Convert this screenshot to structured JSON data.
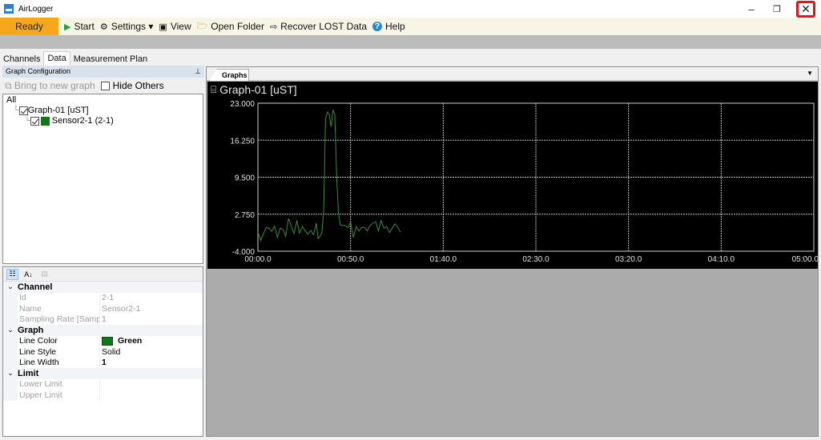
{
  "window": {
    "title": "AirLogger",
    "minimize": "–",
    "maximize": "❐",
    "close": "✕"
  },
  "toolbar": {
    "status": "Ready",
    "items": [
      {
        "icon": "play-icon",
        "glyph": "▶",
        "label": "Start"
      },
      {
        "icon": "gear-icon",
        "glyph": "⚙",
        "label": "Settings ▾"
      },
      {
        "icon": "chart-icon",
        "glyph": "▣",
        "label": "View"
      },
      {
        "icon": "folder-icon",
        "glyph": "🗁",
        "label": "Open Folder"
      },
      {
        "icon": "recover-icon",
        "glyph": "⇨",
        "label": "Recover LOST Data"
      },
      {
        "icon": "help-icon",
        "glyph": "?",
        "label": "Help"
      }
    ]
  },
  "left_tabs": [
    {
      "label": "Channels"
    },
    {
      "label": "Data",
      "active": true
    },
    {
      "label": "Measurement Plan"
    }
  ],
  "graph_config": {
    "header": "Graph Configuration",
    "pin": "⊥",
    "bring_label": "Bring to new graph",
    "hide_others_label": "Hide Others",
    "tree": {
      "root": "All",
      "graph": "Graph-01 [uST]",
      "sensor": "Sensor2-1 (2-1)",
      "sensor_color": "#0b7a16"
    }
  },
  "properties": {
    "categories": [
      {
        "name": "Channel",
        "rows": [
          {
            "key": "Id",
            "value": "2-1",
            "disabled": true
          },
          {
            "key": "Name",
            "value": "Sensor2-1",
            "disabled": true
          },
          {
            "key": "Sampling Rate [Samp",
            "value": "1",
            "disabled": true
          }
        ]
      },
      {
        "name": "Graph",
        "rows": [
          {
            "key": "Line Color",
            "value": "Green",
            "swatch": "#0b7a16"
          },
          {
            "key": "Line Style",
            "value": "Solid"
          },
          {
            "key": "Line Width",
            "value": "1"
          }
        ]
      },
      {
        "name": "Limit",
        "rows": [
          {
            "key": "Lower Limit",
            "value": "",
            "disabled": true
          },
          {
            "key": "Upper Limit",
            "value": "",
            "disabled": true
          }
        ]
      }
    ]
  },
  "graphs_tab": {
    "label": "Graphs",
    "dropdown": "▼"
  },
  "graph": {
    "title": "Graph-01 [uST]"
  },
  "chart_data": {
    "type": "line",
    "title": "Graph-01 [uST]",
    "xlabel": "",
    "ylabel": "",
    "xlim": [
      0,
      300
    ],
    "ylim": [
      -4.0,
      23.0
    ],
    "yticks": [
      "23.000",
      "16.250",
      "9.500",
      "2.750",
      "-4.000"
    ],
    "ytick_values": [
      23.0,
      16.25,
      9.5,
      2.75,
      -4.0
    ],
    "xticks": [
      "00:00.0",
      "00:50.0",
      "01:40.0",
      "02:30.0",
      "03:20.0",
      "04:10.0",
      "05:00.0"
    ],
    "xtick_values": [
      0,
      50,
      100,
      150,
      200,
      250,
      300
    ],
    "grid": true,
    "series": [
      {
        "name": "Sensor2-1 (2-1)",
        "color": "#3d8a3d",
        "x": [
          0,
          1.5,
          3,
          4.5,
          6,
          7.5,
          9,
          10.5,
          12,
          13.5,
          15,
          16.5,
          18,
          19.5,
          21,
          22.5,
          24,
          25.5,
          27,
          28.5,
          30,
          31.5,
          32.5,
          33.5,
          34.5,
          35.5,
          36.5,
          37.5,
          38.5,
          39.5,
          40.5,
          41.5,
          42.5,
          43.5,
          44.5,
          45.5,
          47,
          48.5,
          50,
          51.5,
          53,
          54.5,
          56,
          57.5,
          59,
          60.5,
          62,
          63.5,
          65,
          66.5,
          68,
          69.5,
          71,
          72.5,
          74,
          75.5,
          77
        ],
        "y": [
          -0.5,
          -2.0,
          -0.8,
          0.3,
          0.2,
          -0.4,
          0.6,
          -1.5,
          0.2,
          0.0,
          -1.3,
          2.0,
          0.6,
          -0.8,
          1.6,
          -0.7,
          0.5,
          -0.3,
          -0.9,
          -0.2,
          -1.0,
          1.1,
          -1.7,
          -1.3,
          -0.7,
          3.5,
          20.2,
          21.4,
          20.9,
          18.7,
          21.8,
          20.9,
          9.6,
          2.9,
          0.8,
          0.7,
          0.7,
          0.3,
          1.3,
          -1.5,
          0.5,
          -0.3,
          0.3,
          0.4,
          -0.3,
          0.7,
          1.1,
          1.4,
          -0.3,
          1.6,
          0.2,
          0.5,
          -0.6,
          0.2,
          1.0,
          0.3,
          -0.5
        ]
      }
    ]
  }
}
